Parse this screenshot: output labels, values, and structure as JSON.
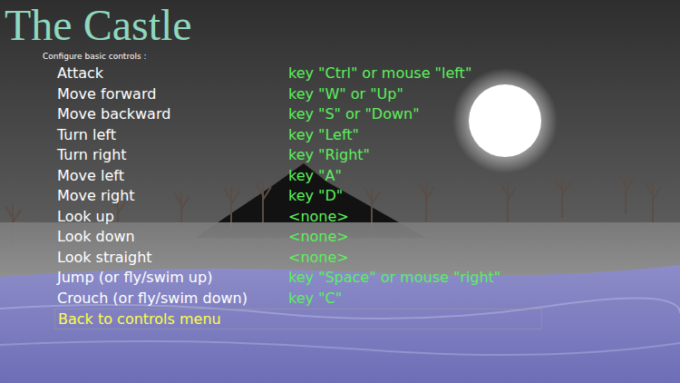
{
  "title": "The Castle",
  "subtitle": "Configure basic controls :",
  "controls": [
    {
      "label": "Attack",
      "binding": "key \"Ctrl\" or mouse \"left\""
    },
    {
      "label": "Move forward",
      "binding": "key \"W\" or \"Up\""
    },
    {
      "label": "Move backward",
      "binding": "key \"S\" or \"Down\""
    },
    {
      "label": "Turn left",
      "binding": "key \"Left\""
    },
    {
      "label": "Turn right",
      "binding": "key \"Right\""
    },
    {
      "label": "Move left",
      "binding": "key \"A\""
    },
    {
      "label": "Move right",
      "binding": "key \"D\""
    },
    {
      "label": "Look up",
      "binding": "<none>"
    },
    {
      "label": "Look down",
      "binding": "<none>"
    },
    {
      "label": "Look straight",
      "binding": "<none>"
    },
    {
      "label": "Jump (or fly/swim up)",
      "binding": "key \"Space\" or mouse \"right\""
    },
    {
      "label": "Crouch (or fly/swim down)",
      "binding": "key \"C\""
    }
  ],
  "back": {
    "label": "Back to controls menu",
    "selected": true
  }
}
